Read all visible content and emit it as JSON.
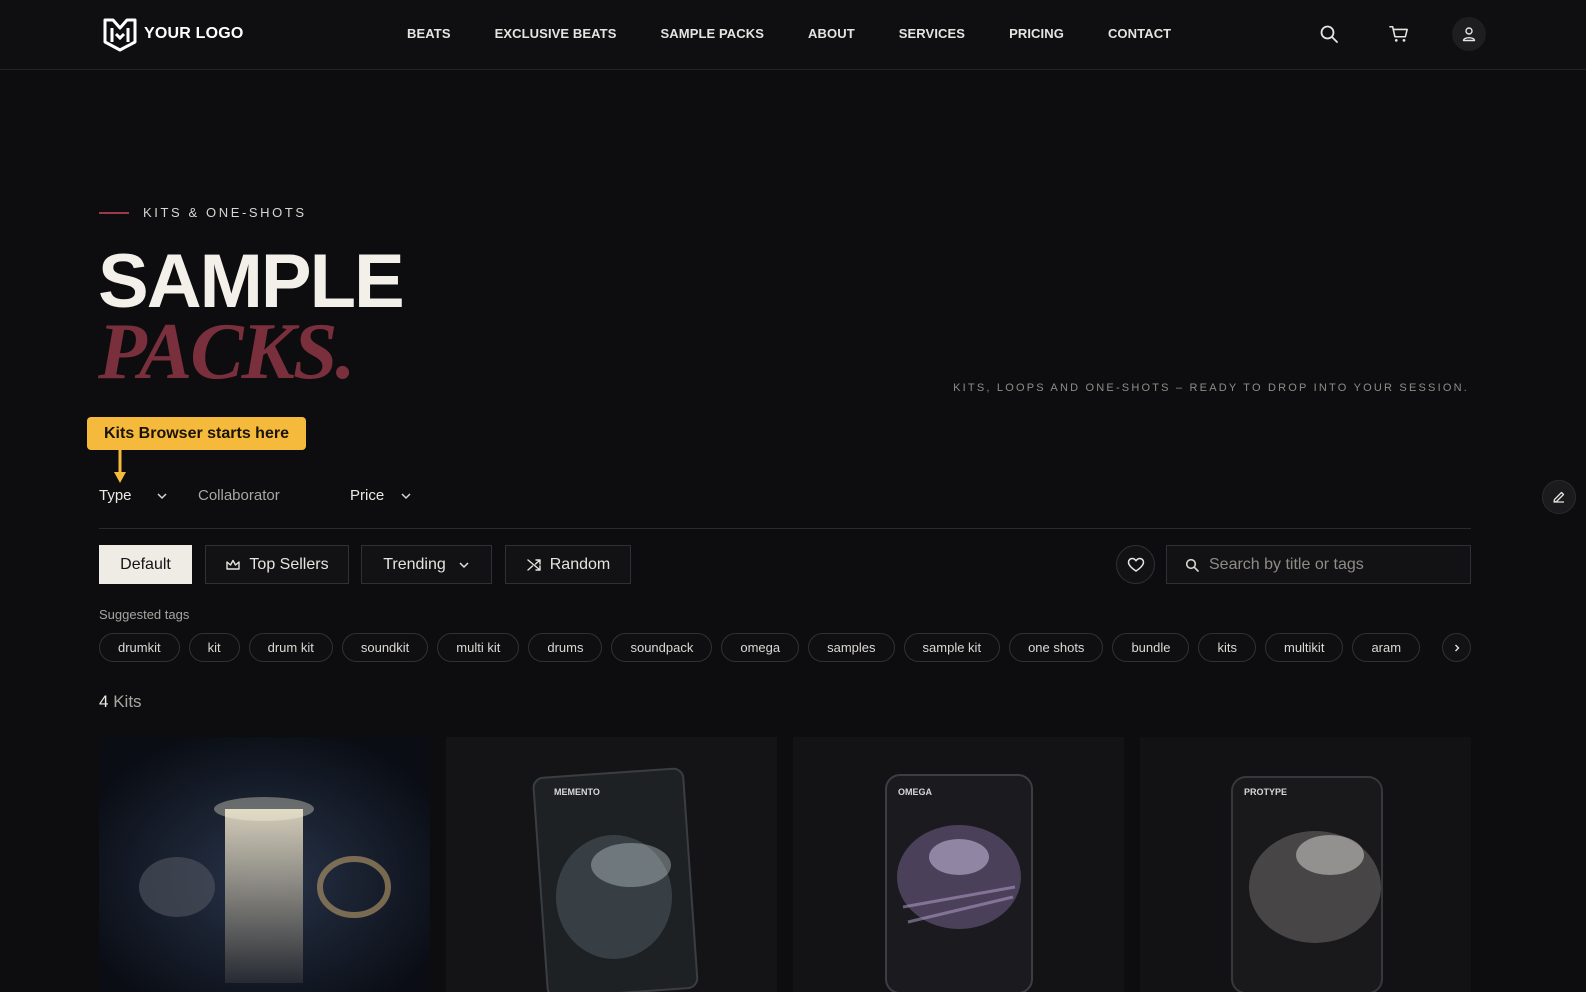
{
  "header": {
    "logo_text": "YOUR LOGO",
    "nav": [
      "BEATS",
      "EXCLUSIVE BEATS",
      "SAMPLE PACKS",
      "ABOUT",
      "SERVICES",
      "PRICING",
      "CONTACT"
    ],
    "icons": [
      "search-icon",
      "cart-icon",
      "user-icon"
    ]
  },
  "hero": {
    "eyebrow": "KITS & ONE-SHOTS",
    "title_line1": "SAMPLE",
    "title_line2": "PACKS.",
    "tagline": "KITS, LOOPS AND ONE-SHOTS – READY TO DROP INTO YOUR SESSION."
  },
  "tooltip": {
    "text": "Kits Browser starts here"
  },
  "filters": {
    "type": "Type",
    "collaborator": "Collaborator",
    "price": "Price"
  },
  "sort": {
    "default": "Default",
    "top_sellers": "Top Sellers",
    "trending": "Trending",
    "random": "Random",
    "active": "Default"
  },
  "search": {
    "placeholder": "Search by title or tags"
  },
  "tags": {
    "label": "Suggested tags",
    "items": [
      "drumkit",
      "kit",
      "drum kit",
      "soundkit",
      "multi kit",
      "drums",
      "soundpack",
      "omega",
      "samples",
      "sample kit",
      "one shots",
      "bundle",
      "kits",
      "multikit",
      "aram"
    ]
  },
  "results": {
    "count": "4",
    "unit": "Kits"
  },
  "cards": [
    {
      "cover_label": ""
    },
    {
      "cover_label": "MEMENTO"
    },
    {
      "cover_label": "OMEGA"
    },
    {
      "cover_label": "PROTYPE"
    }
  ],
  "colors": {
    "background": "#0d0d0f",
    "accent_red": "#7a2f3d",
    "tooltip_yellow": "#f5b93b"
  }
}
